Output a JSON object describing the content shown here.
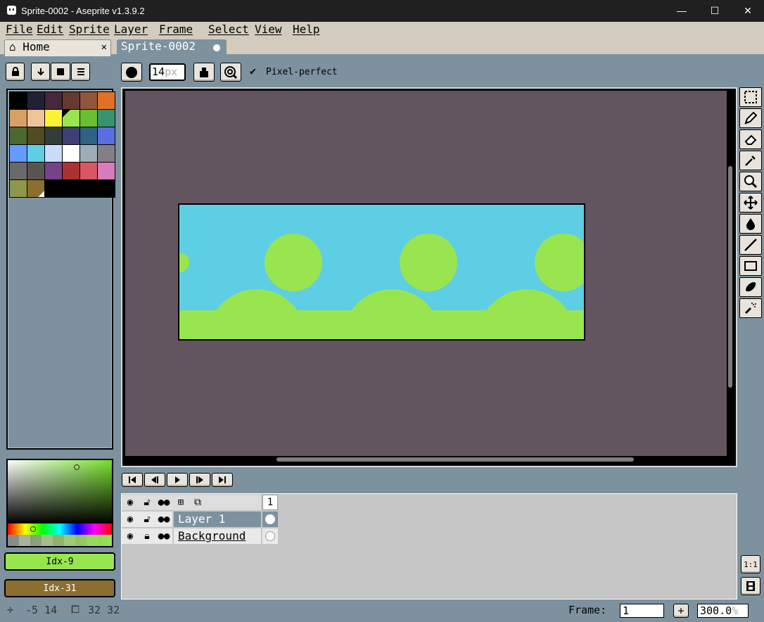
{
  "window": {
    "title": "Sprite-0002 - Aseprite v1.3.9.2",
    "minimize": "—",
    "maximize": "☐",
    "close": "✕"
  },
  "menu": [
    "File",
    "Edit",
    "Sprite",
    "Layer",
    "Frame",
    "Select",
    "View",
    "Help"
  ],
  "tabs": {
    "home": "Home",
    "home_close": "✕",
    "sprite": "Sprite-0002"
  },
  "toolbar": {
    "brush_size": "14",
    "brush_unit": "px",
    "pixel_perfect": "Pixel-perfect"
  },
  "palette": {
    "colors": [
      "#000000",
      "#222034",
      "#45283c",
      "#663931",
      "#8f563b",
      "#df7126",
      "#d9a066",
      "#eec39a",
      "#fbf236",
      "#99e550",
      "#6abe30",
      "#37946e",
      "#4b692f",
      "#524b24",
      "#323c39",
      "#3f3f74",
      "#306082",
      "#5b6ee1",
      "#639bff",
      "#5fcde4",
      "#cbdbfc",
      "#ffffff",
      "#9badb7",
      "#847e87",
      "#696a6a",
      "#595652",
      "#76428a",
      "#ac3232",
      "#d95763",
      "#d77bba",
      "#8f974a",
      "#8a6f30"
    ]
  },
  "colors": {
    "foreground_label": "Idx-9",
    "foreground": "#99e550",
    "background_label": "Idx-31",
    "background": "#8a6f30"
  },
  "timeline": {
    "frame_header": "1",
    "layers": [
      {
        "name": "Layer 1"
      },
      {
        "name": "Background"
      }
    ]
  },
  "status": {
    "cursor": "-5 14",
    "size": "32 32",
    "frame_label": "Frame:",
    "frame_value": "1",
    "zoom": "300.0",
    "zoom_unit": "%"
  },
  "side": {
    "ratio": "1:1"
  }
}
